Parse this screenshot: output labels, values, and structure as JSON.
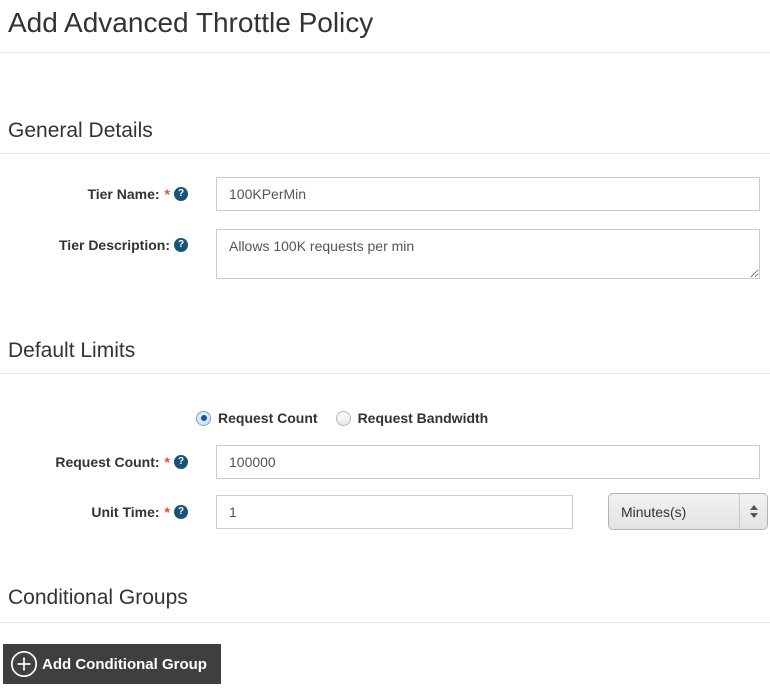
{
  "page": {
    "title": "Add Advanced Throttle Policy"
  },
  "general_details": {
    "heading": "General Details",
    "tier_name": {
      "label": "Tier Name:",
      "required_marker": "*",
      "value": "100KPerMin"
    },
    "tier_description": {
      "label": "Tier Description:",
      "value": "Allows 100K requests per min"
    }
  },
  "default_limits": {
    "heading": "Default Limits",
    "limit_type_options": {
      "request_count": "Request Count",
      "request_bandwidth": "Request Bandwidth"
    },
    "selected_limit_type": "Request Count",
    "request_count": {
      "label": "Request Count:",
      "required_marker": "*",
      "value": "100000"
    },
    "unit_time": {
      "label": "Unit Time:",
      "required_marker": "*",
      "value": "1",
      "unit_selected": "Minutes(s)"
    }
  },
  "conditional_groups": {
    "heading": "Conditional Groups",
    "add_button_label": "Add Conditional Group"
  },
  "icons": {
    "help": "?"
  },
  "colors": {
    "help_icon_bg": "#19537a",
    "required_red": "#e74c3c",
    "button_bg": "#3f3f3f",
    "radio_selected_dot": "#17569d",
    "divider": "#e7e7e7"
  }
}
